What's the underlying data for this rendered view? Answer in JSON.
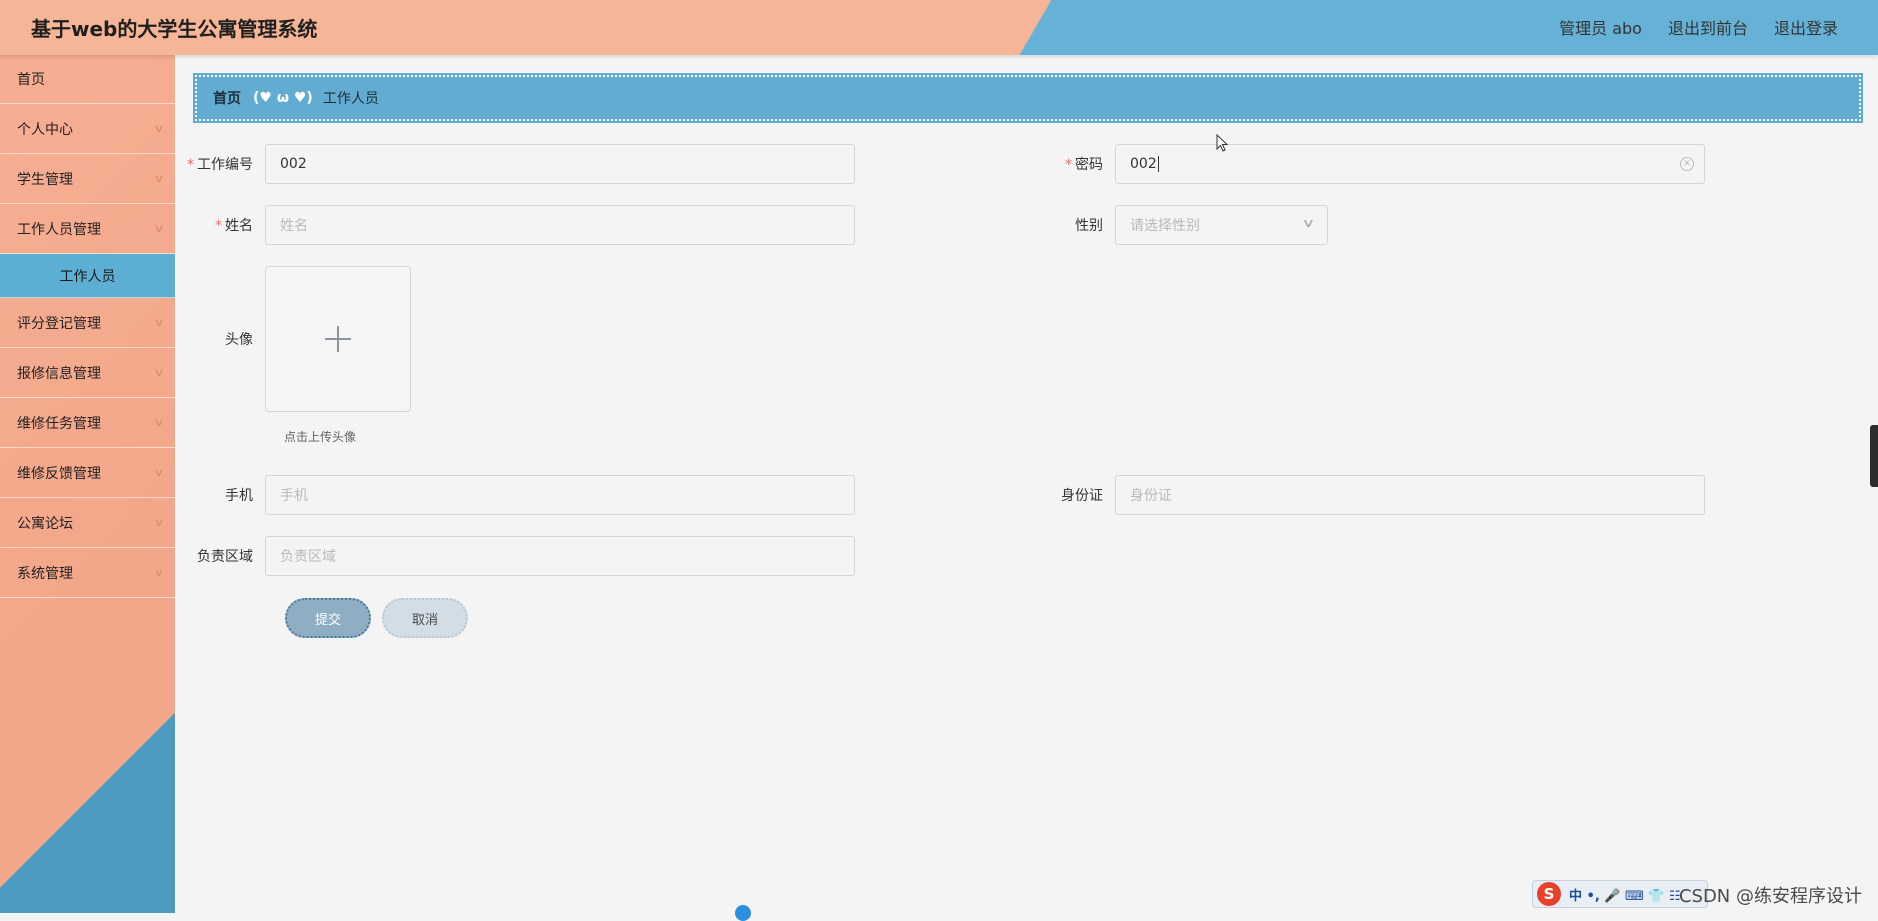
{
  "header": {
    "title": "基于web的大学生公寓管理系统",
    "admin_label": "管理员 abo",
    "exit_front": "退出到前台",
    "logout": "退出登录"
  },
  "sidebar": {
    "items": [
      {
        "label": "首页",
        "has_children": false
      },
      {
        "label": "个人中心",
        "has_children": true
      },
      {
        "label": "学生管理",
        "has_children": true
      },
      {
        "label": "工作人员管理",
        "has_children": true
      },
      {
        "label": "评分登记管理",
        "has_children": true
      },
      {
        "label": "报修信息管理",
        "has_children": true
      },
      {
        "label": "维修任务管理",
        "has_children": true
      },
      {
        "label": "维修反馈管理",
        "has_children": true
      },
      {
        "label": "公寓论坛",
        "has_children": true
      },
      {
        "label": "系统管理",
        "has_children": true
      }
    ],
    "active_sub": "工作人员"
  },
  "breadcrumb": {
    "home": "首页",
    "separator": "(♥ ω ♥)",
    "current": "工作人员"
  },
  "form": {
    "work_no": {
      "label": "工作编号",
      "value": "002",
      "required": true
    },
    "password": {
      "label": "密码",
      "value": "002",
      "required": true
    },
    "name": {
      "label": "姓名",
      "placeholder": "姓名",
      "required": true
    },
    "gender": {
      "label": "性别",
      "placeholder": "请选择性别"
    },
    "avatar": {
      "label": "头像",
      "tip": "点击上传头像"
    },
    "phone": {
      "label": "手机",
      "placeholder": "手机"
    },
    "id_card": {
      "label": "身份证",
      "placeholder": "身份证"
    },
    "area": {
      "label": "负责区域",
      "placeholder": "负责区域"
    },
    "submit_label": "提交",
    "cancel_label": "取消"
  },
  "overlay": {
    "ime_logo": "S",
    "ime_text": "中 •, 🎤 ⌨ 👕 ☷",
    "watermark": "CSDN @练安程序设计"
  },
  "colors": {
    "header_left": "#f6b596",
    "header_right": "#66b1d6",
    "sidebar": "#f3a78a",
    "active_sub": "#5caed3",
    "breadcrumb": "#62acd1"
  }
}
